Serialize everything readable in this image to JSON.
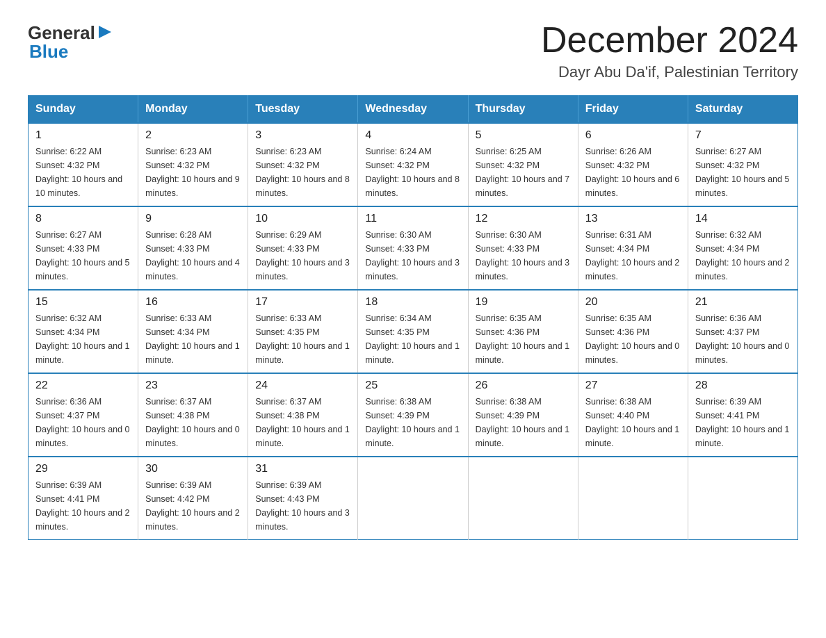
{
  "header": {
    "logo_general": "General",
    "logo_blue": "Blue",
    "month_title": "December 2024",
    "location": "Dayr Abu Da'if, Palestinian Territory"
  },
  "weekdays": [
    "Sunday",
    "Monday",
    "Tuesday",
    "Wednesday",
    "Thursday",
    "Friday",
    "Saturday"
  ],
  "weeks": [
    [
      {
        "day": "1",
        "sunrise": "6:22 AM",
        "sunset": "4:32 PM",
        "daylight": "10 hours and 10 minutes."
      },
      {
        "day": "2",
        "sunrise": "6:23 AM",
        "sunset": "4:32 PM",
        "daylight": "10 hours and 9 minutes."
      },
      {
        "day": "3",
        "sunrise": "6:23 AM",
        "sunset": "4:32 PM",
        "daylight": "10 hours and 8 minutes."
      },
      {
        "day": "4",
        "sunrise": "6:24 AM",
        "sunset": "4:32 PM",
        "daylight": "10 hours and 8 minutes."
      },
      {
        "day": "5",
        "sunrise": "6:25 AM",
        "sunset": "4:32 PM",
        "daylight": "10 hours and 7 minutes."
      },
      {
        "day": "6",
        "sunrise": "6:26 AM",
        "sunset": "4:32 PM",
        "daylight": "10 hours and 6 minutes."
      },
      {
        "day": "7",
        "sunrise": "6:27 AM",
        "sunset": "4:32 PM",
        "daylight": "10 hours and 5 minutes."
      }
    ],
    [
      {
        "day": "8",
        "sunrise": "6:27 AM",
        "sunset": "4:33 PM",
        "daylight": "10 hours and 5 minutes."
      },
      {
        "day": "9",
        "sunrise": "6:28 AM",
        "sunset": "4:33 PM",
        "daylight": "10 hours and 4 minutes."
      },
      {
        "day": "10",
        "sunrise": "6:29 AM",
        "sunset": "4:33 PM",
        "daylight": "10 hours and 3 minutes."
      },
      {
        "day": "11",
        "sunrise": "6:30 AM",
        "sunset": "4:33 PM",
        "daylight": "10 hours and 3 minutes."
      },
      {
        "day": "12",
        "sunrise": "6:30 AM",
        "sunset": "4:33 PM",
        "daylight": "10 hours and 3 minutes."
      },
      {
        "day": "13",
        "sunrise": "6:31 AM",
        "sunset": "4:34 PM",
        "daylight": "10 hours and 2 minutes."
      },
      {
        "day": "14",
        "sunrise": "6:32 AM",
        "sunset": "4:34 PM",
        "daylight": "10 hours and 2 minutes."
      }
    ],
    [
      {
        "day": "15",
        "sunrise": "6:32 AM",
        "sunset": "4:34 PM",
        "daylight": "10 hours and 1 minute."
      },
      {
        "day": "16",
        "sunrise": "6:33 AM",
        "sunset": "4:34 PM",
        "daylight": "10 hours and 1 minute."
      },
      {
        "day": "17",
        "sunrise": "6:33 AM",
        "sunset": "4:35 PM",
        "daylight": "10 hours and 1 minute."
      },
      {
        "day": "18",
        "sunrise": "6:34 AM",
        "sunset": "4:35 PM",
        "daylight": "10 hours and 1 minute."
      },
      {
        "day": "19",
        "sunrise": "6:35 AM",
        "sunset": "4:36 PM",
        "daylight": "10 hours and 1 minute."
      },
      {
        "day": "20",
        "sunrise": "6:35 AM",
        "sunset": "4:36 PM",
        "daylight": "10 hours and 0 minutes."
      },
      {
        "day": "21",
        "sunrise": "6:36 AM",
        "sunset": "4:37 PM",
        "daylight": "10 hours and 0 minutes."
      }
    ],
    [
      {
        "day": "22",
        "sunrise": "6:36 AM",
        "sunset": "4:37 PM",
        "daylight": "10 hours and 0 minutes."
      },
      {
        "day": "23",
        "sunrise": "6:37 AM",
        "sunset": "4:38 PM",
        "daylight": "10 hours and 0 minutes."
      },
      {
        "day": "24",
        "sunrise": "6:37 AM",
        "sunset": "4:38 PM",
        "daylight": "10 hours and 1 minute."
      },
      {
        "day": "25",
        "sunrise": "6:38 AM",
        "sunset": "4:39 PM",
        "daylight": "10 hours and 1 minute."
      },
      {
        "day": "26",
        "sunrise": "6:38 AM",
        "sunset": "4:39 PM",
        "daylight": "10 hours and 1 minute."
      },
      {
        "day": "27",
        "sunrise": "6:38 AM",
        "sunset": "4:40 PM",
        "daylight": "10 hours and 1 minute."
      },
      {
        "day": "28",
        "sunrise": "6:39 AM",
        "sunset": "4:41 PM",
        "daylight": "10 hours and 1 minute."
      }
    ],
    [
      {
        "day": "29",
        "sunrise": "6:39 AM",
        "sunset": "4:41 PM",
        "daylight": "10 hours and 2 minutes."
      },
      {
        "day": "30",
        "sunrise": "6:39 AM",
        "sunset": "4:42 PM",
        "daylight": "10 hours and 2 minutes."
      },
      {
        "day": "31",
        "sunrise": "6:39 AM",
        "sunset": "4:43 PM",
        "daylight": "10 hours and 3 minutes."
      },
      null,
      null,
      null,
      null
    ]
  ]
}
